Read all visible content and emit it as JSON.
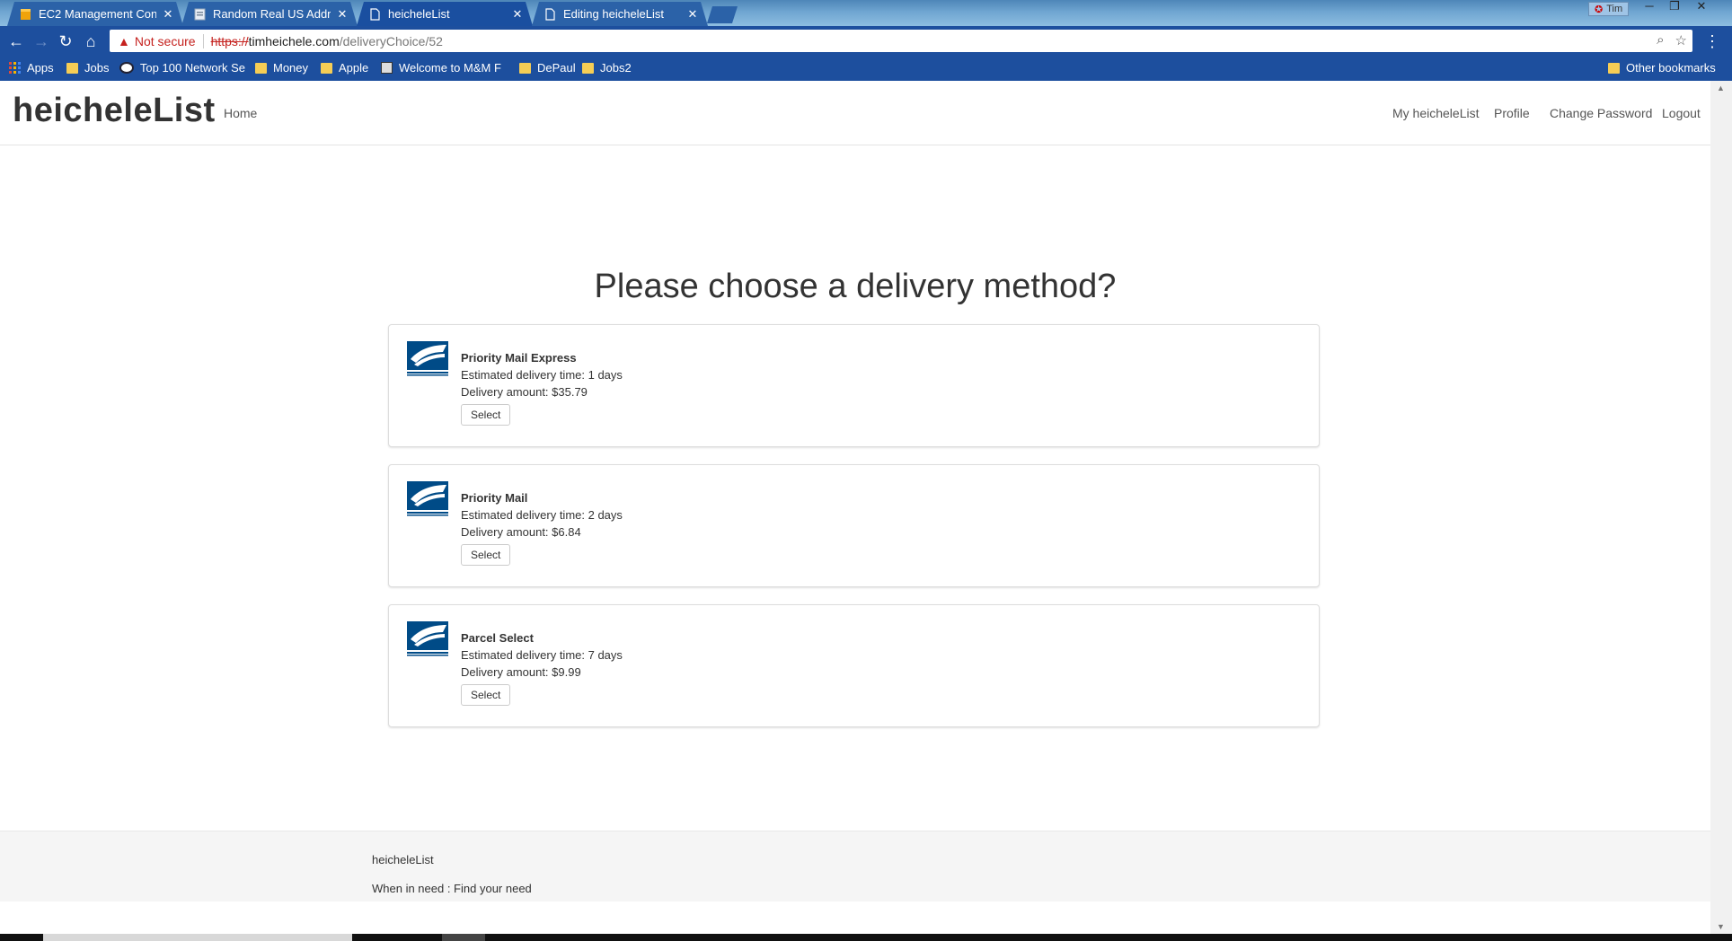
{
  "browser": {
    "tabs": [
      {
        "title": "EC2 Management Conso",
        "icon": "aws-box-icon"
      },
      {
        "title": "Random Real US Addres",
        "icon": "page-icon"
      },
      {
        "title": "heicheleList",
        "icon": "document-icon"
      },
      {
        "title": "Editing heicheleList",
        "icon": "document-icon"
      }
    ],
    "active_tab": 2,
    "window_user": "Tim",
    "security_label": "Not secure",
    "url_scheme": "https://",
    "url_host": "timheichele.com",
    "url_path": "/deliveryChoice/52",
    "bookmarks": [
      "Apps",
      "Jobs",
      "Top 100 Network Se",
      "Money",
      "Apple",
      "Welcome to M&M F",
      "DePaul",
      "Jobs2"
    ],
    "other_bookmarks": "Other bookmarks"
  },
  "site": {
    "brand": "heicheleList",
    "nav_left": [
      "Home"
    ],
    "nav_right": [
      "My heicheleList",
      "Profile",
      "Change Password",
      "Logout"
    ]
  },
  "main": {
    "heading": "Please choose a delivery method?",
    "options": [
      {
        "name": "Priority Mail Express",
        "time": "Estimated delivery time: 1 days",
        "amount": "Delivery amount: $35.79",
        "button": "Select"
      },
      {
        "name": "Priority Mail",
        "time": "Estimated delivery time: 2 days",
        "amount": "Delivery amount: $6.84",
        "button": "Select"
      },
      {
        "name": "Parcel Select",
        "time": "Estimated delivery time: 7 days",
        "amount": "Delivery amount: $9.99",
        "button": "Select"
      }
    ]
  },
  "footer": {
    "brand": "heicheleList",
    "tagline": "When in need : Find your need"
  },
  "colors": {
    "chrome_blue": "#1d4f9e",
    "not_secure_red": "#c5221f",
    "usps_blue": "#004b87"
  }
}
